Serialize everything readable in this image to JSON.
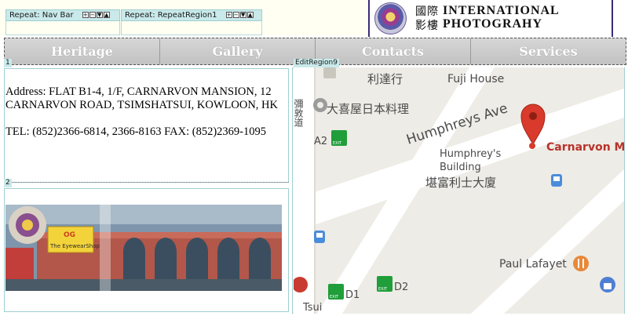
{
  "repeat_regions": [
    {
      "label": "Repeat: Nav Bar"
    },
    {
      "label": "Repeat: RepeatRegion1"
    }
  ],
  "repeat_controls": [
    "+",
    "−",
    "▼",
    "▲"
  ],
  "logo": {
    "chinese_line1": "國際",
    "chinese_line2": "影樓",
    "english_line1": "INTERNATIONAL",
    "english_line2": "PHOTOGRAHY"
  },
  "nav": {
    "items": [
      {
        "label": "Heritage"
      },
      {
        "label": "Gallery"
      },
      {
        "label": "Contacts"
      },
      {
        "label": "Services"
      }
    ]
  },
  "regions": {
    "region1_tag": "1",
    "region2_tag": "2",
    "edit_region9_tag": "EditRegion9"
  },
  "contact": {
    "address": "Address: FLAT B1-4, 1/F, CARNARVON MANSION, 12 CARNARVON ROAD, TSIMSHATSUI, KOWLOON, HK",
    "phone": "TEL: (852)2366-6814, 2366-8163 FAX: (852)2369-1095"
  },
  "photo": {
    "sign1": "The EyewearShop",
    "sign2": "OG"
  },
  "map": {
    "labels": {
      "lee_tat_hong": "利達行",
      "fuji_house": "Fuji House",
      "restaurant": "大喜屋日本料理",
      "humphreys_ave": "Humphreys Ave",
      "carnarvon": "Carnarvon M",
      "a2": "A2",
      "exit": "EXIT",
      "humphreys_building_en1": "Humphrey's",
      "humphreys_building_en2": "Building",
      "humphreys_building_cn": "堪富利士大廈",
      "paul_lafayet": "Paul Lafayet",
      "d1": "D1",
      "d2": "D2",
      "tsui": "Tsui",
      "road_vertical": "彌敦道"
    },
    "colors": {
      "marker": "#d93a2b",
      "exit_green": "#1f9e3a",
      "background": "#eeece6"
    }
  }
}
